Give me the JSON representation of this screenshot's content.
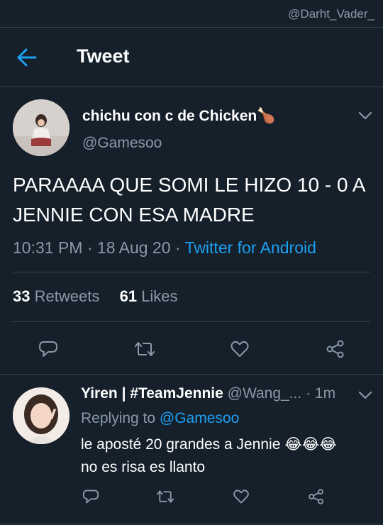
{
  "watermark": "@Darht_Vader_",
  "header": {
    "title": "Tweet"
  },
  "tweet": {
    "display_name": "chichu con c de Chicken🍗",
    "handle": "@Gamesoo",
    "text": "PARAAAA QUE SOMI LE HIZO 10 - 0 A JENNIE CON ESA MADRE",
    "time": "10:31 PM",
    "date": "18 Aug 20",
    "source": "Twitter for Android",
    "retweets_count": "33",
    "retweets_label": "Retweets",
    "likes_count": "61",
    "likes_label": "Likes"
  },
  "reply": {
    "display_name": "Yiren | #TeamJennie",
    "handle": "@Wang_...",
    "time": "1m",
    "replying_to_label": "Replying to",
    "replying_to_handle": "@Gamesoo",
    "text_line1": "le aposté 20 grandes a Jennie 😂😂😂",
    "text_line2": "no es risa es llanto"
  },
  "colors": {
    "background": "#15202b",
    "accent": "#1da1f2",
    "secondary_text": "#8899a6",
    "divider": "#38444d"
  }
}
